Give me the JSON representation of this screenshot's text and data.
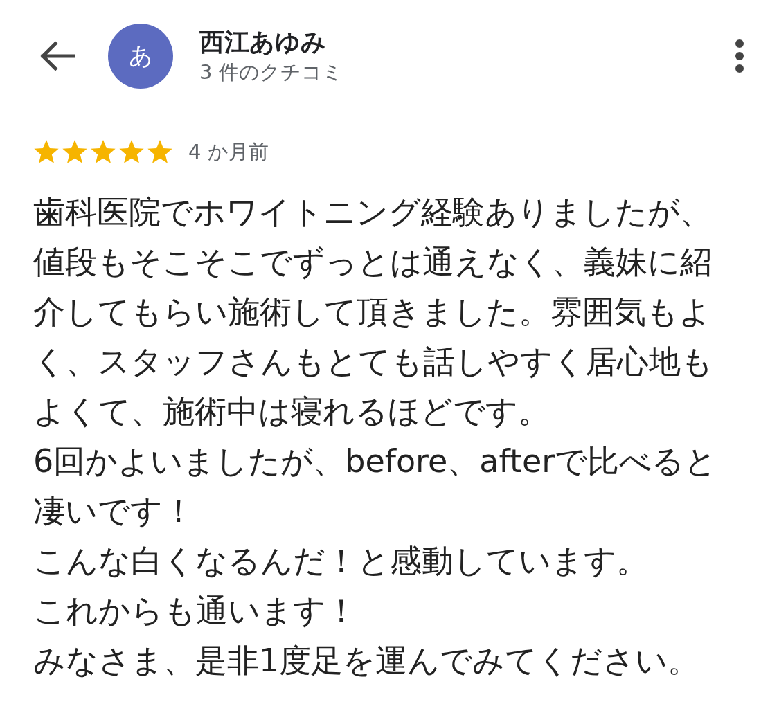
{
  "header": {
    "avatar_letter": "あ",
    "name": "西江あゆみ",
    "review_count": "3 件のクチコミ"
  },
  "review": {
    "stars": 5,
    "time": "4 か月前",
    "paragraphs": [
      "歯科医院でホワイトニング経験ありましたが、値段もそこそこでずっとは通えなく、義妹に紹介してもらい施術して頂きました。雰囲気もよく、スタッフさんもとても話しやすく居心地もよくて、施術中は寝れるほどです。",
      "6回かよいましたが、before、afterで比べると凄いです！",
      "こんな白くなるんだ！と感動しています。",
      "これからも通います！",
      "みなさま、是非1度足を運んでみてください。"
    ]
  }
}
